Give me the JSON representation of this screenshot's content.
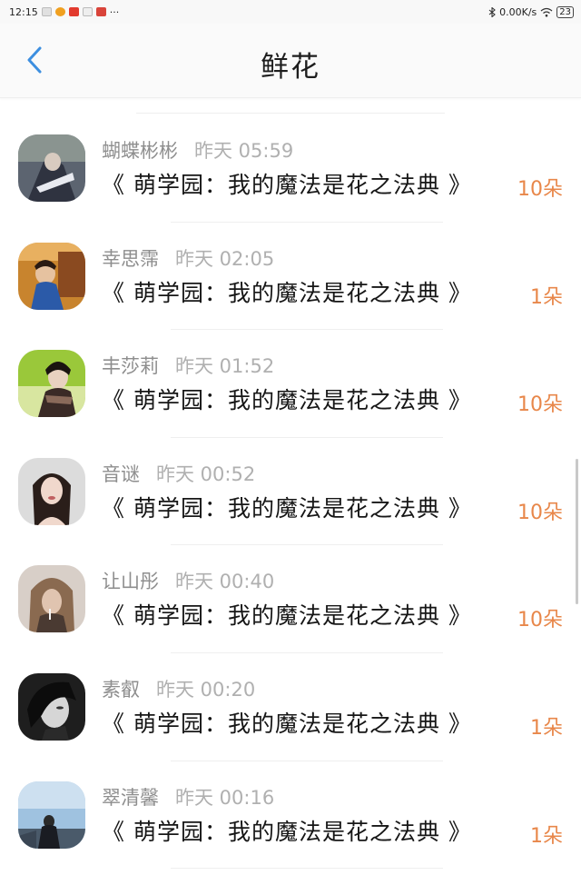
{
  "status_bar": {
    "time": "12:15",
    "more": "···",
    "network_speed": "0.00K/s",
    "battery": "23",
    "bluetooth_icon": "bluetooth-icon",
    "wifi_icon": "wifi-icon"
  },
  "header": {
    "title": "鲜花",
    "back_icon": "chevron-left-icon"
  },
  "items": [
    {
      "name": "蝴蝶彬彬",
      "time": "昨天 05:59",
      "book": "《 萌学园：我的魔法是花之法典 》",
      "count": "10朵"
    },
    {
      "name": "幸思霈",
      "time": "昨天 02:05",
      "book": "《 萌学园：我的魔法是花之法典 》",
      "count": "1朵"
    },
    {
      "name": "丰莎莉",
      "time": "昨天 01:52",
      "book": "《 萌学园：我的魔法是花之法典 》",
      "count": "10朵"
    },
    {
      "name": "音谜",
      "time": "昨天 00:52",
      "book": "《 萌学园：我的魔法是花之法典 》",
      "count": "10朵"
    },
    {
      "name": "让山彤",
      "time": "昨天 00:40",
      "book": "《 萌学园：我的魔法是花之法典 》",
      "count": "10朵"
    },
    {
      "name": "素叡",
      "time": "昨天 00:20",
      "book": "《 萌学园：我的魔法是花之法典 》",
      "count": "1朵"
    },
    {
      "name": "翠清馨",
      "time": "昨天 00:16",
      "book": "《 萌学园：我的魔法是花之法典 》",
      "count": "1朵"
    }
  ],
  "colors": {
    "accent_blue": "#3d8fe0",
    "count_orange": "#e8874a",
    "name_gray": "#8e8e8e"
  }
}
